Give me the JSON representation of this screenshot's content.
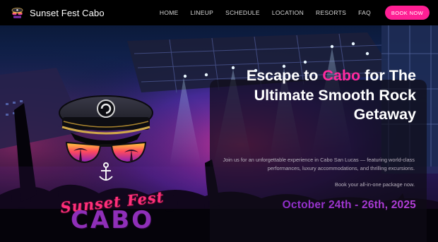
{
  "header": {
    "brand": "Sunset Fest Cabo",
    "logo_icon": "sunset-fest-logo-icon",
    "nav": [
      "HOME",
      "LINEUP",
      "SCHEDULE",
      "LOCATION",
      "RESORTS",
      "FAQ"
    ],
    "book_button": "BOOK NOW"
  },
  "hero": {
    "headline_pre": "Escape to ",
    "headline_accent": "Cabo",
    "headline_post": " for The Ultimate Smooth Rock Getaway",
    "description": "Join us for an unforgettable experience in Cabo San Lucas — featuring world-class performances, luxury accommodations, and thrilling excursions.",
    "cta_text": "Book your all-in-one package now.",
    "dates": "October 24th - 26th, 2025",
    "badge": {
      "script_line": "Sunset Fest",
      "block_line": "CABO"
    }
  },
  "colors": {
    "accent_pink": "#ff1f94",
    "headline_accent": "#ff2a9d",
    "dates_purple": "#9b34cf",
    "header_bg": "#000000"
  }
}
